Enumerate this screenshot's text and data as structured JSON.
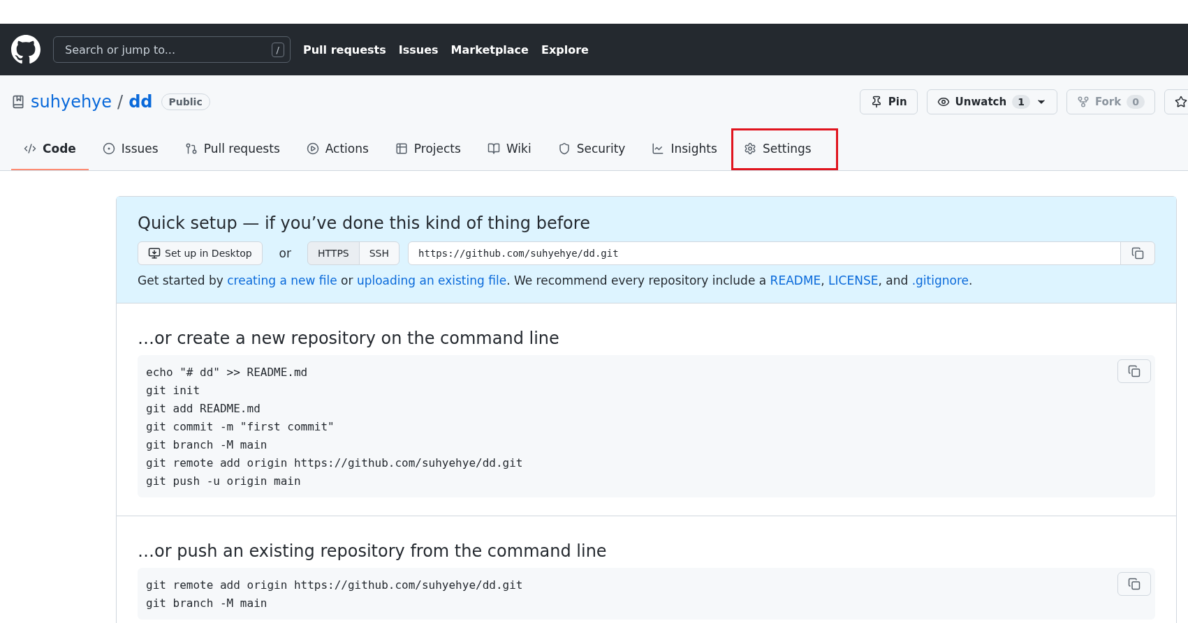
{
  "header": {
    "search_placeholder": "Search or jump to...",
    "search_key": "/",
    "nav": [
      "Pull requests",
      "Issues",
      "Marketplace",
      "Explore"
    ]
  },
  "repo": {
    "owner": "suhyehye",
    "separator": "/",
    "name": "dd",
    "visibility": "Public",
    "actions": [
      {
        "kind": "pin",
        "label": "Pin",
        "disabled": false
      },
      {
        "kind": "watch",
        "label": "Unwatch",
        "count": "1",
        "disabled": false
      },
      {
        "kind": "fork",
        "label": "Fork",
        "count": "0",
        "disabled": true
      },
      {
        "kind": "star",
        "disabled": false
      }
    ]
  },
  "tabs": [
    {
      "kind": "code",
      "label": "Code",
      "selected": true,
      "highlighted": false
    },
    {
      "kind": "issues",
      "label": "Issues",
      "selected": false,
      "highlighted": false
    },
    {
      "kind": "pulls",
      "label": "Pull requests",
      "selected": false,
      "highlighted": false
    },
    {
      "kind": "actions",
      "label": "Actions",
      "selected": false,
      "highlighted": false
    },
    {
      "kind": "projects",
      "label": "Projects",
      "selected": false,
      "highlighted": false
    },
    {
      "kind": "wiki",
      "label": "Wiki",
      "selected": false,
      "highlighted": false
    },
    {
      "kind": "security",
      "label": "Security",
      "selected": false,
      "highlighted": false
    },
    {
      "kind": "insights",
      "label": "Insights",
      "selected": false,
      "highlighted": false
    },
    {
      "kind": "settings",
      "label": "Settings",
      "selected": false,
      "highlighted": true
    }
  ],
  "quick_setup": {
    "title": "Quick setup — if you’ve done this kind of thing before",
    "desktop_button": "Set up in Desktop",
    "or": "or",
    "protocols": [
      {
        "label": "HTTPS",
        "selected": true
      },
      {
        "label": "SSH",
        "selected": false
      }
    ],
    "url": "https://github.com/suhyehye/dd.git",
    "hint": [
      {
        "kind": "text",
        "text": "Get started by "
      },
      {
        "kind": "link",
        "text": "creating a new file"
      },
      {
        "kind": "text",
        "text": " or "
      },
      {
        "kind": "link",
        "text": "uploading an existing file"
      },
      {
        "kind": "text",
        "text": ". We recommend every repository include a "
      },
      {
        "kind": "link",
        "text": "README"
      },
      {
        "kind": "text",
        "text": ", "
      },
      {
        "kind": "link",
        "text": "LICENSE"
      },
      {
        "kind": "text",
        "text": ", and "
      },
      {
        "kind": "link",
        "text": ".gitignore"
      },
      {
        "kind": "text",
        "text": "."
      }
    ]
  },
  "sections": [
    {
      "title": "…or create a new repository on the command line",
      "lines": [
        "echo \"# dd\" >> README.md",
        "git init",
        "git add README.md",
        "git commit -m \"first commit\"",
        "git branch -M main",
        "git remote add origin https://github.com/suhyehye/dd.git",
        "git push -u origin main"
      ]
    },
    {
      "title": "…or push an existing repository from the command line",
      "lines": [
        "git remote add origin https://github.com/suhyehye/dd.git",
        "git branch -M main"
      ]
    }
  ]
}
